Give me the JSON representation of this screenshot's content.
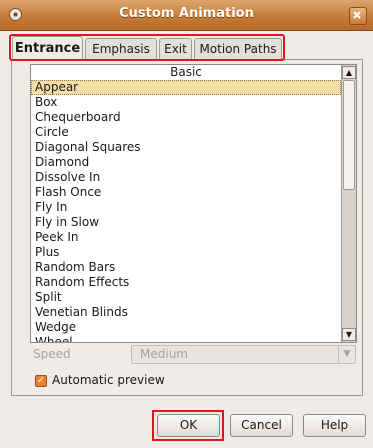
{
  "window": {
    "title": "Custom Animation",
    "close_symbol": "✕"
  },
  "tabs": [
    {
      "label": "Entrance",
      "active": true
    },
    {
      "label": "Emphasis",
      "active": false
    },
    {
      "label": "Exit",
      "active": false
    },
    {
      "label": "Motion Paths",
      "active": false
    }
  ],
  "list": {
    "header": "Basic",
    "selected": "Appear",
    "items": [
      "Appear",
      "Box",
      "Chequerboard",
      "Circle",
      "Diagonal Squares",
      "Diamond",
      "Dissolve In",
      "Flash Once",
      "Fly In",
      "Fly in Slow",
      "Peek In",
      "Plus",
      "Random Bars",
      "Random Effects",
      "Split",
      "Venetian Blinds",
      "Wedge",
      "Wheel"
    ]
  },
  "speed": {
    "label": "Speed",
    "value": "Medium"
  },
  "automatic_preview": {
    "label": "Automatic preview",
    "checked": true
  },
  "buttons": {
    "ok": "OK",
    "cancel": "Cancel",
    "help": "Help"
  },
  "colors": {
    "highlight": "#e0151d",
    "titlebar": "#c57c3b",
    "selection": "#f5dda8"
  }
}
